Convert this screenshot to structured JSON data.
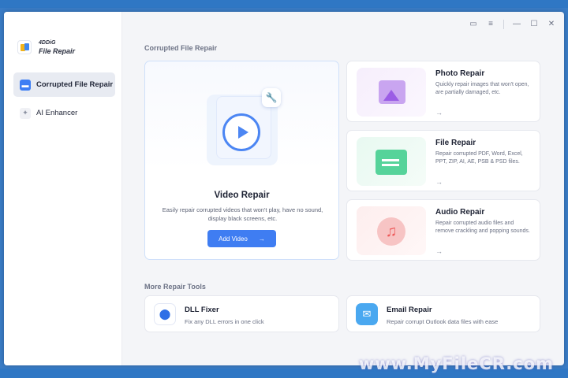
{
  "app": {
    "brand": "4DDiG",
    "product": "File Repair"
  },
  "sidebar": {
    "items": [
      {
        "label": "Corrupted File Repair",
        "icon": "folder-icon",
        "active": true
      },
      {
        "label": "AI Enhancer",
        "icon": "sparkle-wand-icon",
        "active": false
      }
    ]
  },
  "titlebar": {
    "icons": [
      "feedback-icon",
      "menu-icon",
      "minimize-icon",
      "maximize-icon",
      "close-icon"
    ]
  },
  "main": {
    "section_title": "Corrupted File Repair",
    "video": {
      "title": "Video Repair",
      "description": "Easily repair corrupted videos that won't play, have no sound, display black screens, etc.",
      "button_label": "Add Video",
      "button_arrow": "→"
    },
    "cards": [
      {
        "title": "Photo Repair",
        "description": "Quickly repair images that won't open, are partially damaged, etc.",
        "arrow": "→"
      },
      {
        "title": "File Repair",
        "description": "Repair corrupted PDF, Word, Excel, PPT, ZIP, AI, AE, PSB & PSD files.",
        "arrow": "→"
      },
      {
        "title": "Audio Repair",
        "description": "Repair corrupted audio files and remove crackling and popping sounds.",
        "arrow": "→"
      }
    ],
    "more_title": "More Repair Tools",
    "tools": [
      {
        "title": "DLL Fixer",
        "description": "Fix any DLL errors in one click"
      },
      {
        "title": "Email Repair",
        "description": "Repair corrupt Outlook data files with ease"
      }
    ]
  },
  "watermark": "www.MyFileCR.com",
  "colors": {
    "accent": "#3f7df2",
    "frame": "#2f77c4",
    "background": "#f4f5f8"
  }
}
